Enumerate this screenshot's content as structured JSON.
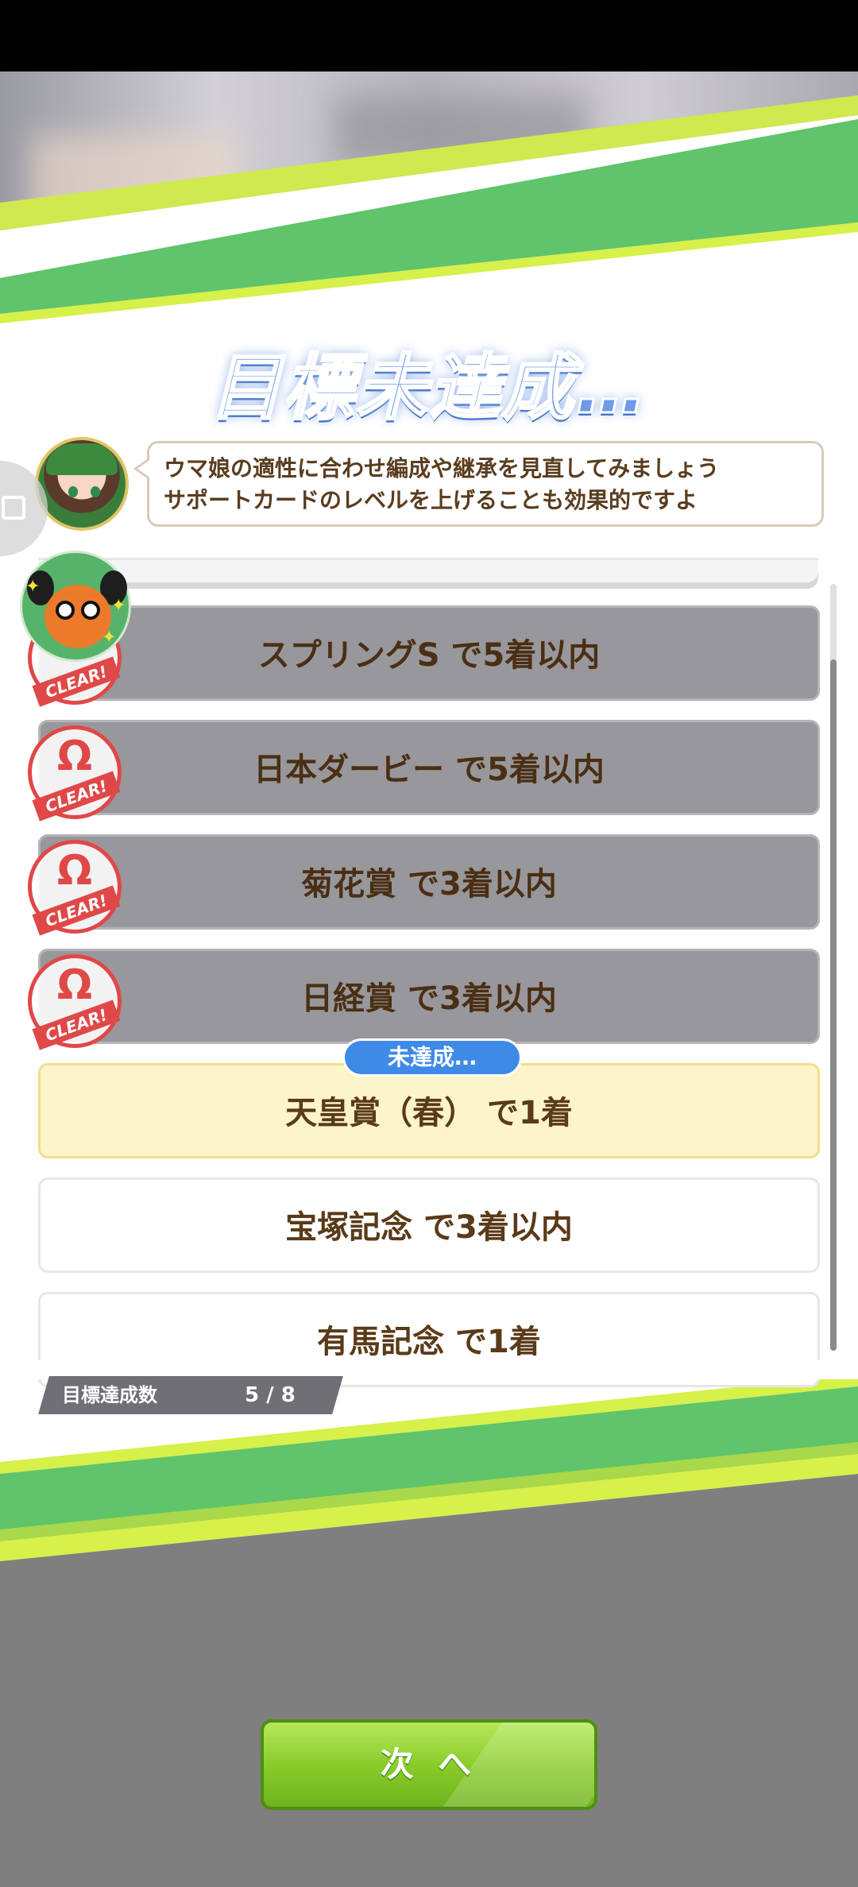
{
  "screen": {
    "title": "目標未達成…",
    "message_line1": "ウマ娘の適性に合わせ編成や継承を見直してみましょう",
    "message_line2": "サポートカードのレベルを上げることも効果的ですよ"
  },
  "goals": [
    {
      "text": "スプリングS で5着以内",
      "status": "cleared",
      "stamp": "CLEAR!"
    },
    {
      "text": "日本ダービー で5着以内",
      "status": "cleared",
      "stamp": "CLEAR!"
    },
    {
      "text": "菊花賞 で3着以内",
      "status": "cleared",
      "stamp": "CLEAR!"
    },
    {
      "text": "日経賞 で3着以内",
      "status": "cleared",
      "stamp": "CLEAR!"
    },
    {
      "text": "天皇賞（春） で1着",
      "status": "current",
      "badge": "未達成…"
    },
    {
      "text": "宝塚記念 で3着以内",
      "status": "pending"
    },
    {
      "text": "有馬記念 で1着",
      "status": "pending"
    }
  ],
  "progress": {
    "label": "目標達成数",
    "value": "5 / 8"
  },
  "next_button": {
    "label": "次 へ"
  },
  "colors": {
    "stripe_green": "#5fc46a",
    "stripe_lime": "#d7f04a",
    "accent_blue": "#3f8ae6",
    "clear_red": "#e04848"
  }
}
